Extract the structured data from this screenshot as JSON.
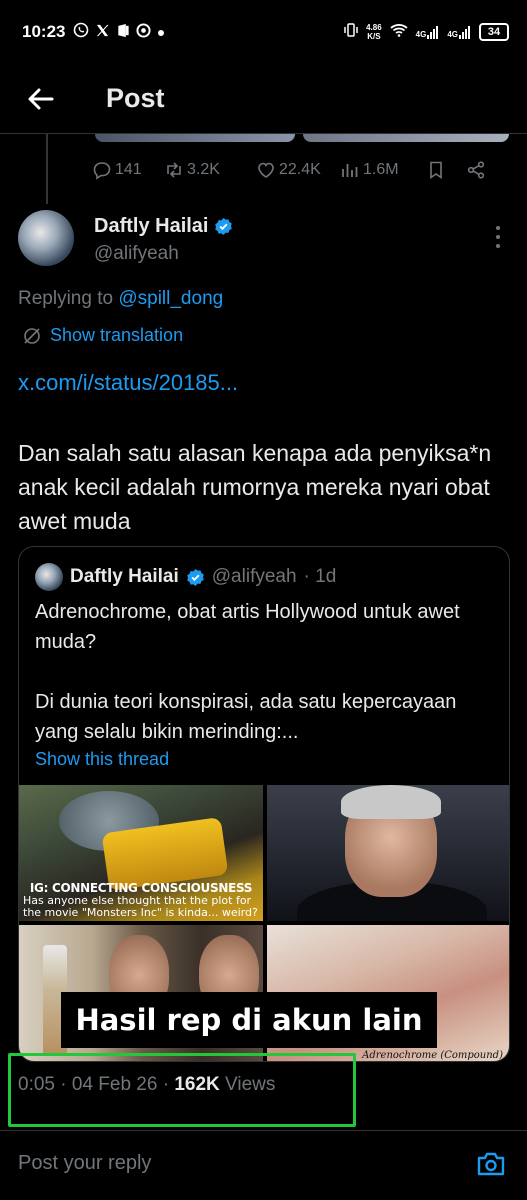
{
  "status_bar": {
    "time": "10:23",
    "net_speed_value": "4.86",
    "net_speed_unit": "K/S",
    "signal1": "4G",
    "signal2": "4G",
    "battery": "34"
  },
  "header": {
    "title": "Post"
  },
  "actions": {
    "replies": "141",
    "reposts": "3.2K",
    "likes": "22.4K",
    "views": "1.6M"
  },
  "author": {
    "name": "Daftly Hailai",
    "handle": "@alifyeah"
  },
  "replying": {
    "prefix": "Replying to",
    "mention": "@spill_dong"
  },
  "show_translation": "Show translation",
  "link": "x.com/i/status/20185...",
  "body": "Dan salah satu alasan kenapa ada penyiksa*n anak kecil adalah rumornya mereka nyari obat awet muda",
  "quote": {
    "name": "Daftly Hailai",
    "handle": "@alifyeah",
    "time": "· 1d",
    "paragraph1": "Adrenochrome, obat artis Hollywood untuk awet muda?",
    "paragraph2": "Di dunia teori konspirasi, ada satu kepercayaan yang selalu bikin merinding:...",
    "show_thread": "Show this thread",
    "meme_title": "IG: CONNECTING CONSCIOUSNESS",
    "meme_text": "Has anyone else thought that the plot for the movie \"Monsters Inc\" is kinda... weird?",
    "image_caption": "Adrenochrome (Compound)"
  },
  "overlay_caption": "Hasil rep di akun lain",
  "meta": {
    "time": "0:05",
    "date": "04 Feb 26",
    "views_count": "162K",
    "views_label": "Views"
  },
  "reply_placeholder": "Post your reply",
  "colors": {
    "background": "#000000",
    "accent": "#1d9bf0",
    "muted": "#71767b",
    "highlight_box": "#22c73a"
  }
}
